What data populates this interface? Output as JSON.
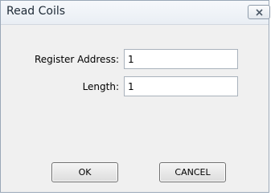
{
  "window": {
    "title": "Read Coils",
    "close_icon": "close-icon"
  },
  "form": {
    "register_address_label": "Register Address:",
    "register_address_value": "1",
    "length_label": "Length:",
    "length_value": "1"
  },
  "buttons": {
    "ok_label": "OK",
    "cancel_label": "CANCEL"
  }
}
